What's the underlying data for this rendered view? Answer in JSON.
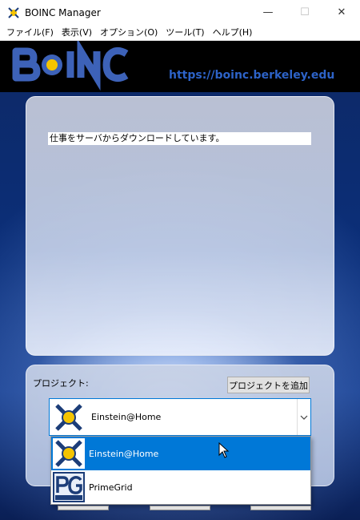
{
  "window": {
    "title": "BOINC Manager",
    "icon": "boinc-icon",
    "controls": [
      "minimize",
      "maximize",
      "close"
    ]
  },
  "menu": {
    "items": [
      "ファイル(F)",
      "表示(V)",
      "オプション(O)",
      "ツール(T)",
      "ヘルプ(H)"
    ]
  },
  "banner": {
    "url": "https://boinc.berkeley.edu"
  },
  "status": {
    "message": "仕事をサーバからダウンロードしています。"
  },
  "project_panel": {
    "label": "プロジェクト:",
    "add_button": "プロジェクトを追加",
    "selected": "Einstein@Home",
    "options": [
      "Einstein@Home",
      "PrimeGrid"
    ]
  },
  "colors": {
    "accent": "#0078d7",
    "banner_url": "#2d63c8"
  }
}
